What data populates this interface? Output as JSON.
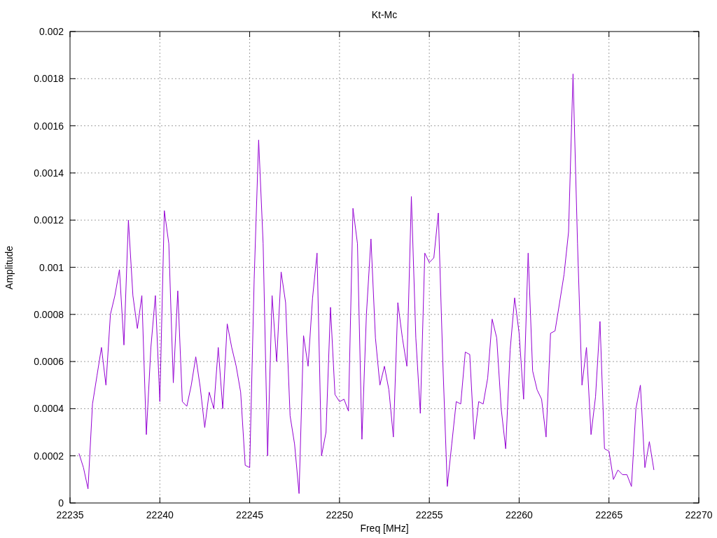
{
  "chart_data": {
    "type": "line",
    "title": "Kt-Mc",
    "xlabel": "Freq [MHz]",
    "ylabel": "Amplitude",
    "xlim": [
      22235,
      22270
    ],
    "ylim": [
      0,
      0.002
    ],
    "xticks": [
      22235,
      22240,
      22245,
      22250,
      22255,
      22260,
      22265,
      22270
    ],
    "yticks": [
      0,
      0.0002,
      0.0004,
      0.0006,
      0.0008,
      0.001,
      0.0012,
      0.0014,
      0.0016,
      0.0018,
      0.002
    ],
    "x": [
      22235.5,
      22235.75,
      22236,
      22236.25,
      22236.5,
      22236.75,
      22237,
      22237.25,
      22237.5,
      22237.75,
      22238,
      22238.25,
      22238.5,
      22238.75,
      22239,
      22239.25,
      22239.5,
      22239.75,
      22240,
      22240.25,
      22240.5,
      22240.75,
      22241,
      22241.25,
      22241.5,
      22241.75,
      22242,
      22242.25,
      22242.5,
      22242.75,
      22243,
      22243.25,
      22243.5,
      22243.75,
      22244,
      22244.25,
      22244.5,
      22244.75,
      22245,
      22245.25,
      22245.5,
      22245.75,
      22246,
      22246.25,
      22246.5,
      22246.75,
      22247,
      22247.25,
      22247.5,
      22247.75,
      22248,
      22248.25,
      22248.5,
      22248.75,
      22249,
      22249.25,
      22249.5,
      22249.75,
      22250,
      22250.25,
      22250.5,
      22250.75,
      22251,
      22251.25,
      22251.5,
      22251.75,
      22252,
      22252.25,
      22252.5,
      22252.75,
      22253,
      22253.25,
      22253.5,
      22253.75,
      22254,
      22254.25,
      22254.5,
      22254.75,
      22255,
      22255.25,
      22255.5,
      22255.75,
      22256,
      22256.25,
      22256.5,
      22256.75,
      22257,
      22257.25,
      22257.5,
      22257.75,
      22258,
      22258.25,
      22258.5,
      22258.75,
      22259,
      22259.25,
      22259.5,
      22259.75,
      22260,
      22260.25,
      22260.5,
      22260.75,
      22261,
      22261.25,
      22261.5,
      22261.75,
      22262,
      22262.25,
      22262.5,
      22262.75,
      22263,
      22263.25,
      22263.5,
      22263.75,
      22264,
      22264.25,
      22264.5,
      22264.75,
      22265,
      22265.25,
      22265.5,
      22265.75,
      22266,
      22266.25,
      22266.5,
      22266.75,
      22267,
      22267.25,
      22267.5
    ],
    "grid": true,
    "series": [
      {
        "color": "#9400d3",
        "values": [
          0.00021,
          0.00015,
          6e-05,
          0.00042,
          0.00054,
          0.00066,
          0.0005,
          0.0008,
          0.00088,
          0.00099,
          0.00067,
          0.0012,
          0.00088,
          0.00074,
          0.00088,
          0.00029,
          0.00066,
          0.00088,
          0.00043,
          0.00124,
          0.0011,
          0.00051,
          0.0009,
          0.00043,
          0.00041,
          0.0005,
          0.00062,
          0.00049,
          0.00032,
          0.00047,
          0.0004,
          0.00066,
          0.0004,
          0.00076,
          0.00066,
          0.00058,
          0.00047,
          0.00016,
          0.00015,
          0.00095,
          0.00154,
          0.0011,
          0.0002,
          0.00088,
          0.0006,
          0.00098,
          0.00085,
          0.00037,
          0.00025,
          4e-05,
          0.00071,
          0.00058,
          0.00087,
          0.00106,
          0.0002,
          0.0003,
          0.00083,
          0.00046,
          0.00043,
          0.00044,
          0.00039,
          0.00125,
          0.0011,
          0.00027,
          0.0008,
          0.00112,
          0.0007,
          0.0005,
          0.00058,
          0.00048,
          0.00028,
          0.00085,
          0.0007,
          0.00058,
          0.0013,
          0.0007,
          0.00038,
          0.00106,
          0.00102,
          0.00104,
          0.00123,
          0.0006,
          7e-05,
          0.00025,
          0.00043,
          0.00042,
          0.00064,
          0.00063,
          0.00027,
          0.00043,
          0.00042,
          0.00053,
          0.00078,
          0.0007,
          0.0004,
          0.00023,
          0.00065,
          0.00087,
          0.00072,
          0.00044,
          0.00106,
          0.00056,
          0.00048,
          0.00044,
          0.00028,
          0.00072,
          0.00073,
          0.00085,
          0.00097,
          0.00115,
          0.00182,
          0.0011,
          0.0005,
          0.00066,
          0.00029,
          0.00045,
          0.00077,
          0.00023,
          0.00022,
          0.0001,
          0.00014,
          0.00012,
          0.00012,
          7e-05,
          0.0004,
          0.0005,
          0.00015,
          0.00026,
          0.00014
        ]
      }
    ]
  }
}
